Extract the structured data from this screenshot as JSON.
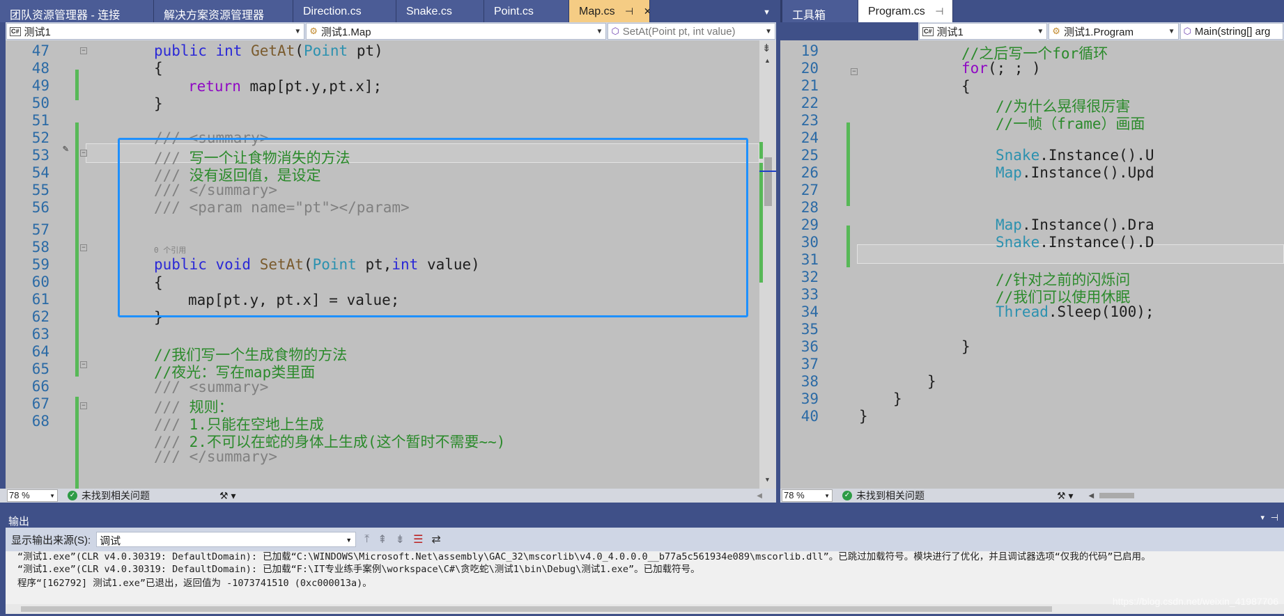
{
  "left_tabs": [
    {
      "label": "团队资源管理器 - 连接",
      "active": false
    },
    {
      "label": "解决方案资源管理器",
      "active": false
    },
    {
      "label": "Direction.cs",
      "active": false
    },
    {
      "label": "Snake.cs",
      "active": false
    },
    {
      "label": "Point.cs",
      "active": false
    },
    {
      "label": "Map.cs",
      "active": true
    }
  ],
  "right_tabs": [
    {
      "label": "工具箱",
      "active": false
    },
    {
      "label": "Program.cs",
      "active": true
    }
  ],
  "left_nav": {
    "project": "测试1",
    "class": "测试1.Map",
    "member": "SetAt(Point pt, int value)"
  },
  "right_nav": {
    "project": "测试1",
    "class": "测试1.Program",
    "member": "Main(string[] arg"
  },
  "left_lines": [
    {
      "n": "47"
    },
    {
      "n": "48"
    },
    {
      "n": "49"
    },
    {
      "n": "50"
    },
    {
      "n": "51"
    },
    {
      "n": "52"
    },
    {
      "n": "53"
    },
    {
      "n": "54"
    },
    {
      "n": "55"
    },
    {
      "n": "56"
    },
    {
      "n": "57"
    },
    {
      "n": "58"
    },
    {
      "n": "59"
    },
    {
      "n": "60"
    },
    {
      "n": "61"
    },
    {
      "n": "62"
    },
    {
      "n": "63"
    },
    {
      "n": "64"
    },
    {
      "n": "65"
    },
    {
      "n": "66"
    },
    {
      "n": "67"
    },
    {
      "n": "68"
    }
  ],
  "left_code": {
    "l47_kw": "public int ",
    "l47_m": "GetAt",
    "l47_p1": "(",
    "l47_ty": "Point",
    "l47_p2": " pt)",
    "l48": "{",
    "l49_cf": "return ",
    "l49_rest": "map[pt.y,pt.x];",
    "l50": "}",
    "l52": "/// <summary>",
    "l53_g": "/// ",
    "l53_c": "写一个让食物消失的方法",
    "l54_g": "/// ",
    "l54_c": "没有返回值，是设定",
    "l55": "/// </summary>",
    "l56_g": "/// <param name=",
    "l56_s": "\"pt\"",
    "l56_g2": "></param>",
    "codelens": "0 个引用",
    "l57_kw": "public void ",
    "l57_m": "SetAt",
    "l57_p1": "(",
    "l57_ty": "Point",
    "l57_p2": " pt,",
    "l57_kw2": "int",
    "l57_p3": " value)",
    "l58": "{",
    "l59": "map[pt.y, pt.x] = value;",
    "l60": "}",
    "l62": "//我们写一个生成食物的方法",
    "l63": "//夜光：写在map类里面",
    "l64": "/// <summary>",
    "l65_g": "/// ",
    "l65_c": "规则：",
    "l66_g": "/// ",
    "l66_c": "1.只能在空地上生成",
    "l67_g": "/// ",
    "l67_c": "2.不可以在蛇的身体上生成(这个暂时不需要~~)",
    "l68": "/// </summary>"
  },
  "right_lines": [
    {
      "n": "19"
    },
    {
      "n": "20"
    },
    {
      "n": "21"
    },
    {
      "n": "22"
    },
    {
      "n": "23"
    },
    {
      "n": "24"
    },
    {
      "n": "25"
    },
    {
      "n": "26"
    },
    {
      "n": "27"
    },
    {
      "n": "28"
    },
    {
      "n": "29"
    },
    {
      "n": "30"
    },
    {
      "n": "31"
    },
    {
      "n": "32"
    },
    {
      "n": "33"
    },
    {
      "n": "34"
    },
    {
      "n": "35"
    },
    {
      "n": "36"
    },
    {
      "n": "37"
    },
    {
      "n": "38"
    },
    {
      "n": "39"
    },
    {
      "n": "40"
    }
  ],
  "right_code": {
    "r19": "//之后写一个for循环",
    "r20_kw": "for",
    "r20_rest": "(; ; )",
    "r21": "{",
    "r22": "//为什么晃得很厉害",
    "r23": "//一帧（frame）画面",
    "r25_t": "Snake",
    "r25_r": ".Instance().U",
    "r26_t": "Map",
    "r26_r": ".Instance().Upd",
    "r29_t": "Map",
    "r29_r": ".Instance().Dra",
    "r30_t": "Snake",
    "r30_r": ".Instance().D",
    "r32": "//针对之前的闪烁问",
    "r33": "//我们可以使用休眠",
    "r34_t": "Thread",
    "r34_r": ".Sleep(100);",
    "r36": "}",
    "r38": "}",
    "r39": "}",
    "r40": "}"
  },
  "status": {
    "zoom": "78 %",
    "issues": "未找到相关问题"
  },
  "output": {
    "title": "输出",
    "source_label": "显示输出来源(S):",
    "source_value": "调试",
    "lines": [
      "“测试1.exe”(CLR v4.0.30319: DefaultDomain): 已加载“C:\\WINDOWS\\Microsoft.Net\\assembly\\GAC_32\\mscorlib\\v4.0_4.0.0.0__b77a5c561934e089\\mscorlib.dll”。已跳过加载符号。模块进行了优化，并且调试器选项“仅我的代码”已启用。",
      "“测试1.exe”(CLR v4.0.30319: DefaultDomain): 已加载“F:\\IT专业练手案例\\workspace\\C#\\贪吃蛇\\测试1\\bin\\Debug\\测试1.exe”。已加载符号。",
      "程序“[162792] 测试1.exe”已退出，返回值为 -1073741510 (0xc000013a)。"
    ]
  },
  "watermark": "https://blog.csdn.net/weixin_41987706",
  "colors": {
    "chrome": "#3f5088",
    "active_tab": "#f5cc84",
    "editor_bg": "#c0c0c0",
    "selection_box": "#1e90ff"
  }
}
